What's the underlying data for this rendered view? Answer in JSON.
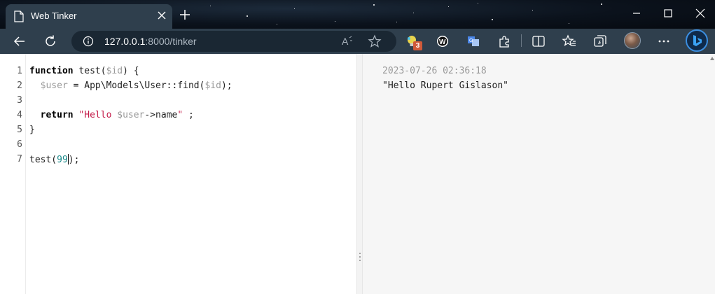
{
  "browser": {
    "tab_title": "Web Tinker",
    "url_host": "127.0.0.1",
    "url_rest": ":8000/tinker",
    "extension_badge": "3"
  },
  "editor": {
    "line_numbers": [
      "1",
      "2",
      "3",
      "4",
      "5",
      "6",
      "7"
    ],
    "lines": {
      "l1_kw": "function",
      "l1_a": " test(",
      "l1_var": "$id",
      "l1_b": ") {",
      "l2_var1": "$user",
      "l2_a": " = App\\Models\\User::find(",
      "l2_var2": "$id",
      "l2_b": ");",
      "l4_kw": "return",
      "l4_str1": "\"Hello ",
      "l4_var": "$user",
      "l4_a": "->name",
      "l4_str2": "\"",
      "l4_b": " ;",
      "l5": "}",
      "l7_a": "test(",
      "l7_num1": "99",
      "l7_b": ");"
    }
  },
  "output": {
    "timestamp": "2023-07-26 02:36:18",
    "result": "\"Hello Rupert Gislason\""
  },
  "colors": {
    "chrome_bg": "#2f3f4d",
    "string": "#c41a48",
    "number": "#1a8a8a",
    "variable": "#999999"
  }
}
